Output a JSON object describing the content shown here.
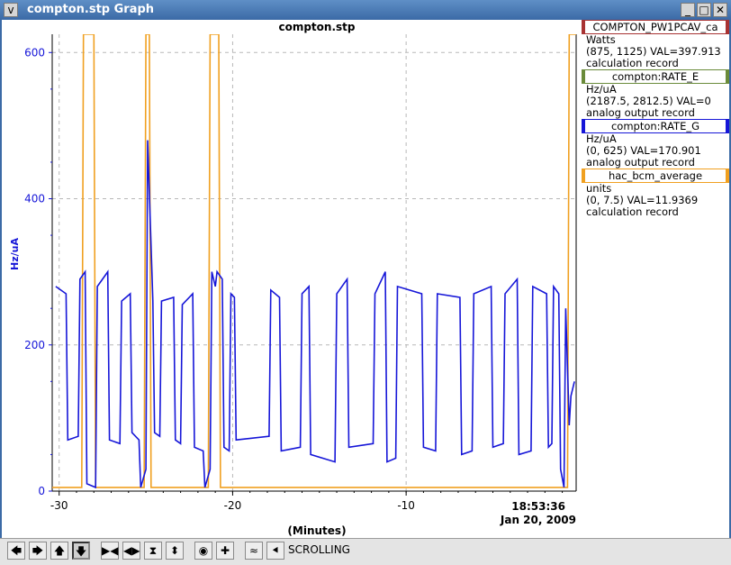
{
  "window": {
    "title": "compton.stp Graph",
    "buttons": {
      "menu": "v",
      "minimize": "_",
      "maximize": "□",
      "close": "✕"
    }
  },
  "legend": [
    {
      "name": "COMPTON_PW1PCAV_ca",
      "color": "#a83232",
      "units": "Watts",
      "range_value": "(875, 1125) VAL=397.913",
      "record": "calculation record"
    },
    {
      "name": "compton:RATE_E",
      "color": "#6a8b3a",
      "units": "Hz/uA",
      "range_value": "(2187.5, 2812.5)  VAL=0",
      "record": "analog output record"
    },
    {
      "name": "compton:RATE_G",
      "color": "#1616d8",
      "units": "Hz/uA",
      "range_value": "(0, 625) VAL=170.901",
      "record": "analog output record"
    },
    {
      "name": "hac_bcm_average",
      "color": "#f0a020",
      "units": "units",
      "range_value": "(0, 7.5) VAL=11.9369",
      "record": "calculation record"
    }
  ],
  "chart_data": {
    "type": "line",
    "title": "compton.stp",
    "xlabel": "(Minutes)",
    "ylabel": "Hz/uA",
    "xlim": [
      -30.4,
      -0.2
    ],
    "ylim": [
      0,
      625
    ],
    "x_ticks": [
      -30,
      -20,
      -10
    ],
    "x_tick_labels": [
      "-30",
      "-20",
      "-10"
    ],
    "y_ticks": [
      0,
      200,
      400,
      600
    ],
    "y_tick_labels": [
      "0",
      "200",
      "400",
      "600"
    ],
    "end_time": "18:53:36",
    "end_date": "Jan 20, 2009",
    "grid": true,
    "series": [
      {
        "name": "compton:RATE_G",
        "color": "#1616d8",
        "x": [
          -30.2,
          -29.6,
          -29.5,
          -28.9,
          -28.8,
          -28.5,
          -28.4,
          -27.9,
          -27.8,
          -27.2,
          -27.1,
          -26.5,
          -26.4,
          -25.9,
          -25.8,
          -25.4,
          -25.3,
          -25.0,
          -24.9,
          -24.6,
          -24.5,
          -24.2,
          -24.1,
          -23.4,
          -23.3,
          -23.0,
          -22.9,
          -22.3,
          -22.2,
          -21.7,
          -21.6,
          -21.3,
          -21.2,
          -21.0,
          -20.9,
          -20.6,
          -20.5,
          -20.2,
          -20.1,
          -19.9,
          -19.8,
          -17.9,
          -17.8,
          -17.3,
          -17.2,
          -16.1,
          -16.0,
          -15.6,
          -15.5,
          -14.1,
          -14.0,
          -13.4,
          -13.3,
          -11.9,
          -11.8,
          -11.2,
          -11.1,
          -10.6,
          -10.5,
          -9.1,
          -9.0,
          -8.3,
          -8.2,
          -6.9,
          -6.8,
          -6.2,
          -6.1,
          -5.1,
          -5.0,
          -4.4,
          -4.3,
          -3.6,
          -3.5,
          -2.8,
          -2.7,
          -1.9,
          -1.8,
          -1.6,
          -1.5,
          -1.2,
          -1.1,
          -0.9,
          -0.8,
          -0.6,
          -0.5,
          -0.3
        ],
        "values": [
          280,
          270,
          70,
          75,
          290,
          300,
          10,
          5,
          280,
          300,
          70,
          65,
          260,
          270,
          80,
          70,
          5,
          30,
          480,
          260,
          80,
          75,
          260,
          265,
          70,
          65,
          255,
          270,
          60,
          55,
          5,
          30,
          300,
          280,
          300,
          290,
          60,
          55,
          270,
          265,
          70,
          75,
          275,
          265,
          55,
          60,
          270,
          280,
          50,
          40,
          270,
          290,
          60,
          65,
          270,
          300,
          40,
          45,
          280,
          270,
          60,
          55,
          270,
          265,
          50,
          55,
          270,
          280,
          60,
          65,
          270,
          290,
          50,
          55,
          280,
          270,
          60,
          65,
          280,
          270,
          30,
          5,
          250,
          90,
          130,
          150
        ]
      },
      {
        "name": "hac_bcm_average",
        "color": "#f0a020",
        "x": [
          -30.4,
          -28.7,
          -28.6,
          -28.0,
          -27.9,
          -25.1,
          -25.0,
          -24.8,
          -24.7,
          -21.4,
          -21.3,
          -20.8,
          -20.7,
          -0.7,
          -0.6,
          -0.2
        ],
        "values": [
          5,
          5,
          625,
          625,
          5,
          5,
          625,
          625,
          5,
          5,
          625,
          625,
          5,
          5,
          625,
          625
        ]
      }
    ]
  },
  "toolbar": {
    "buttons": [
      {
        "name": "scroll-left-button",
        "glyph": "🡄"
      },
      {
        "name": "scroll-right-button",
        "glyph": "🡆"
      },
      {
        "name": "scroll-up-button",
        "glyph": "🡅"
      },
      {
        "name": "scroll-down-button",
        "glyph": "🡇"
      },
      {
        "name": "zoom-in-x-button",
        "glyph": "▶◀"
      },
      {
        "name": "zoom-out-x-button",
        "glyph": "◀▶"
      },
      {
        "name": "zoom-in-y-button",
        "glyph": "⧗"
      },
      {
        "name": "zoom-out-y-button",
        "glyph": "⬍"
      },
      {
        "name": "reset-button",
        "glyph": "◉"
      },
      {
        "name": "add-button",
        "glyph": "✚"
      },
      {
        "name": "autoscale-button",
        "glyph": "≈"
      },
      {
        "name": "scrolling-toggle-button",
        "glyph": "⯇"
      }
    ],
    "status": "SCROLLING"
  }
}
